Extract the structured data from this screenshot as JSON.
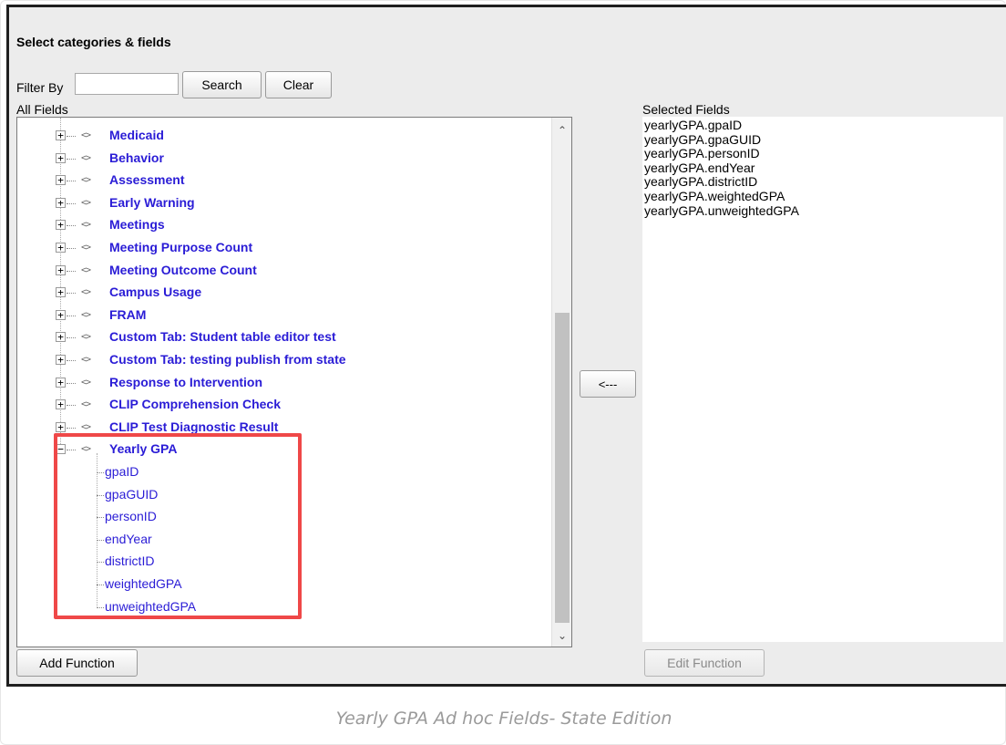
{
  "panel": {
    "title": "Select categories & fields",
    "filter_label": "Filter By",
    "filter_value": "",
    "search_label": "Search",
    "clear_label": "Clear",
    "all_fields_label": "All Fields",
    "selected_fields_label": "Selected Fields",
    "move_left_label": "<---",
    "add_function_label": "Add Function",
    "edit_function_label": "Edit Function"
  },
  "categories": [
    {
      "label": "Medicaid"
    },
    {
      "label": "Behavior"
    },
    {
      "label": "Assessment"
    },
    {
      "label": "Early Warning"
    },
    {
      "label": "Meetings"
    },
    {
      "label": "Meeting Purpose Count"
    },
    {
      "label": "Meeting Outcome Count"
    },
    {
      "label": "Campus Usage"
    },
    {
      "label": "FRAM"
    },
    {
      "label": "Custom Tab: Student table editor test"
    },
    {
      "label": "Custom Tab: testing publish from state"
    },
    {
      "label": "Response to Intervention"
    },
    {
      "label": "CLIP Comprehension Check"
    },
    {
      "label": "CLIP Test Diagnostic Result"
    },
    {
      "label": "Yearly GPA"
    }
  ],
  "yearly_gpa_fields": [
    "gpaID",
    "gpaGUID",
    "personID",
    "endYear",
    "districtID",
    "weightedGPA",
    "unweightedGPA"
  ],
  "selected_fields": [
    "yearlyGPA.gpaID",
    "yearlyGPA.gpaGUID",
    "yearlyGPA.personID",
    "yearlyGPA.endYear",
    "yearlyGPA.districtID",
    "yearlyGPA.weightedGPA",
    "yearlyGPA.unweightedGPA"
  ],
  "caption": "Yearly GPA Ad hoc Fields- State Edition",
  "colors": {
    "link": "#2a1cd6",
    "highlight": "#ef4848",
    "panel_bg": "#ececec"
  },
  "icons": {
    "expand": "plus-icon",
    "collapse": "minus-icon",
    "category": "tag-icon",
    "scroll_up": "chevron-up-icon",
    "scroll_down": "chevron-down-icon"
  }
}
